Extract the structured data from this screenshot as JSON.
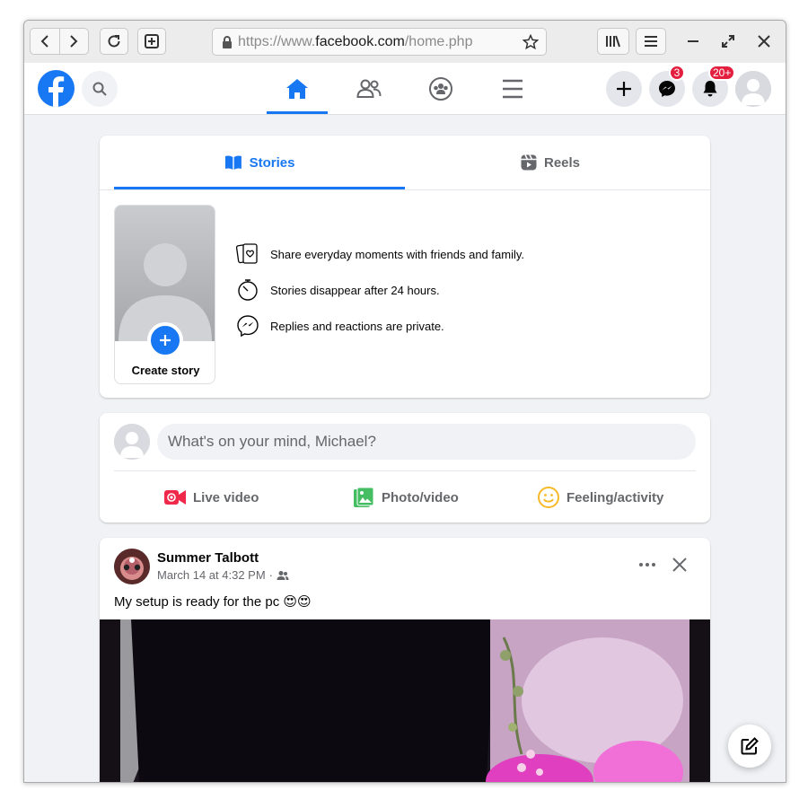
{
  "browser": {
    "url_prefix": "https://www.",
    "url_domain": "facebook.com",
    "url_path": "/home.php"
  },
  "header": {
    "messenger_badge": "3",
    "notifications_badge": "20+"
  },
  "stories": {
    "tabs": [
      {
        "label": "Stories",
        "active": true
      },
      {
        "label": "Reels",
        "active": false
      }
    ],
    "create_label": "Create story",
    "info": [
      "Share everyday moments with friends and family.",
      "Stories disappear after 24 hours.",
      "Replies and reactions are private."
    ]
  },
  "composer": {
    "placeholder": "What's on your mind, Michael?",
    "actions": [
      {
        "label": "Live video",
        "icon": "live-video-icon",
        "color": "#f02849"
      },
      {
        "label": "Photo/video",
        "icon": "photo-icon",
        "color": "#45bd62"
      },
      {
        "label": "Feeling/activity",
        "icon": "feeling-icon",
        "color": "#f7b928"
      }
    ]
  },
  "post": {
    "author": "Summer Talbott",
    "timestamp": "March 14 at 4:32 PM",
    "separator": "·",
    "text": "My setup is ready for the pc 😍😍"
  },
  "colors": {
    "accent": "#1877f2",
    "badge": "#e41e3f",
    "background": "#f0f2f5"
  }
}
